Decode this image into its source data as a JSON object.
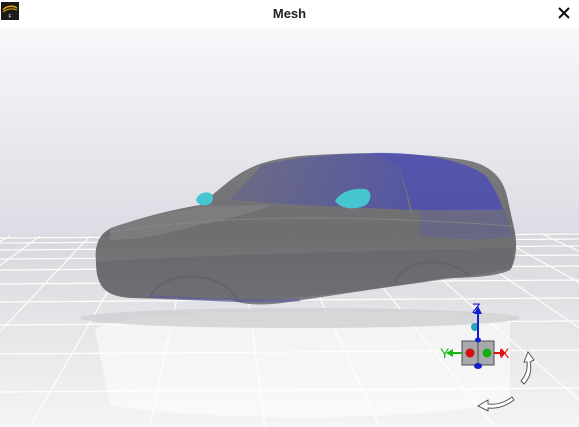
{
  "window": {
    "title": "Mesh"
  },
  "triad": {
    "x_label": "X",
    "y_label": "Y",
    "z_label": "Z",
    "x_color": "#e01010",
    "y_color": "#17b817",
    "z_color": "#1020d0"
  },
  "colors": {
    "car_body": "#6d6d6f",
    "window_tint": "#5a5ab0",
    "highlight": "#45c5cf"
  },
  "icons": [
    "app-logo-icon",
    "close-icon",
    "rotate-vertical-icon",
    "rotate-horizontal-icon"
  ]
}
